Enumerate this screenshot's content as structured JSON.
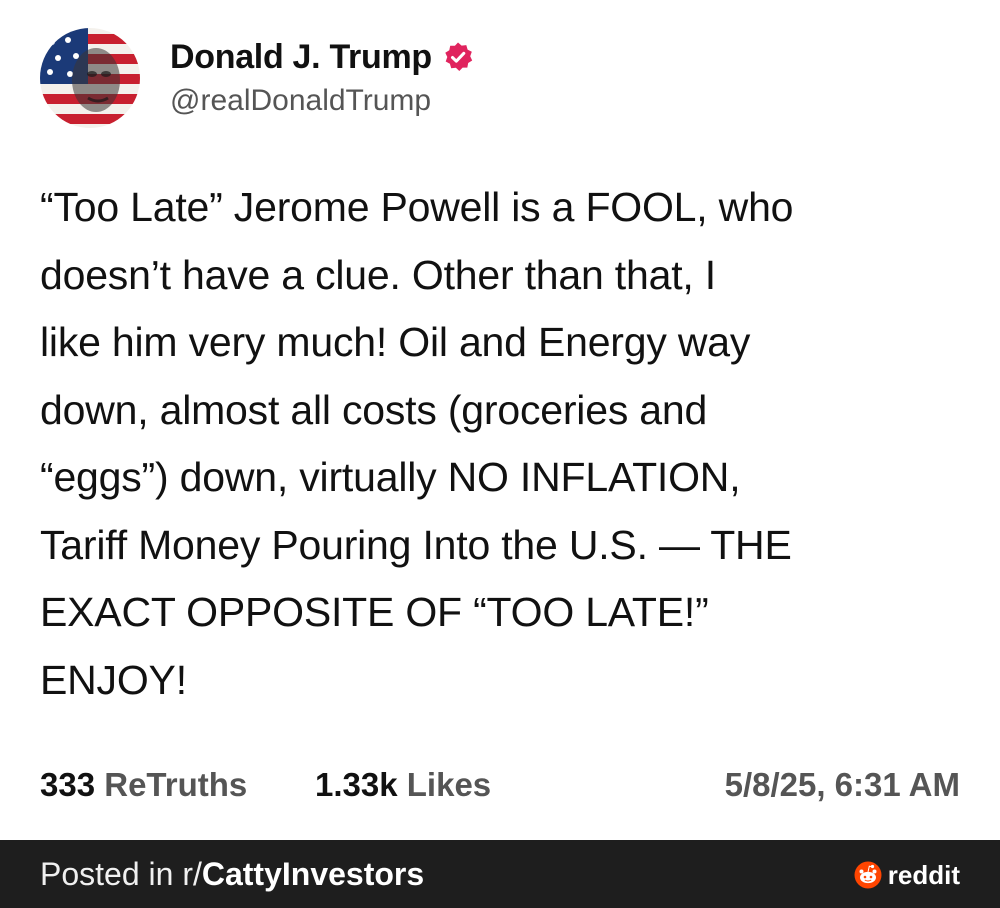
{
  "post": {
    "author": {
      "display_name": "Donald J. Trump",
      "handle": "@realDonaldTrump",
      "verified": true,
      "verified_color": "#e0245e",
      "avatar_icon": "flag-portrait-avatar"
    },
    "body": "“Too Late” Jerome Powell is a FOOL, who\ndoesn’t have a clue. Other than that, I\nlike him very much! Oil and Energy way\ndown, almost all costs (groceries and\n“eggs”) down, virtually NO INFLATION,\nTariff Money Pouring Into the U.S. — THE\nEXACT OPPOSITE OF “TOO LATE!”\nENJOY!",
    "stats": {
      "retruths_count": "333",
      "retruths_label": "ReTruths",
      "likes_count": "1.33k",
      "likes_label": "Likes",
      "timestamp": "5/8/25, 6:31 AM"
    }
  },
  "footer": {
    "posted_in_prefix": "Posted in r/",
    "subreddit": "CattyInvestors",
    "brand": "reddit",
    "brand_icon": "reddit-snoo-icon",
    "brand_color": "#ff4500"
  }
}
